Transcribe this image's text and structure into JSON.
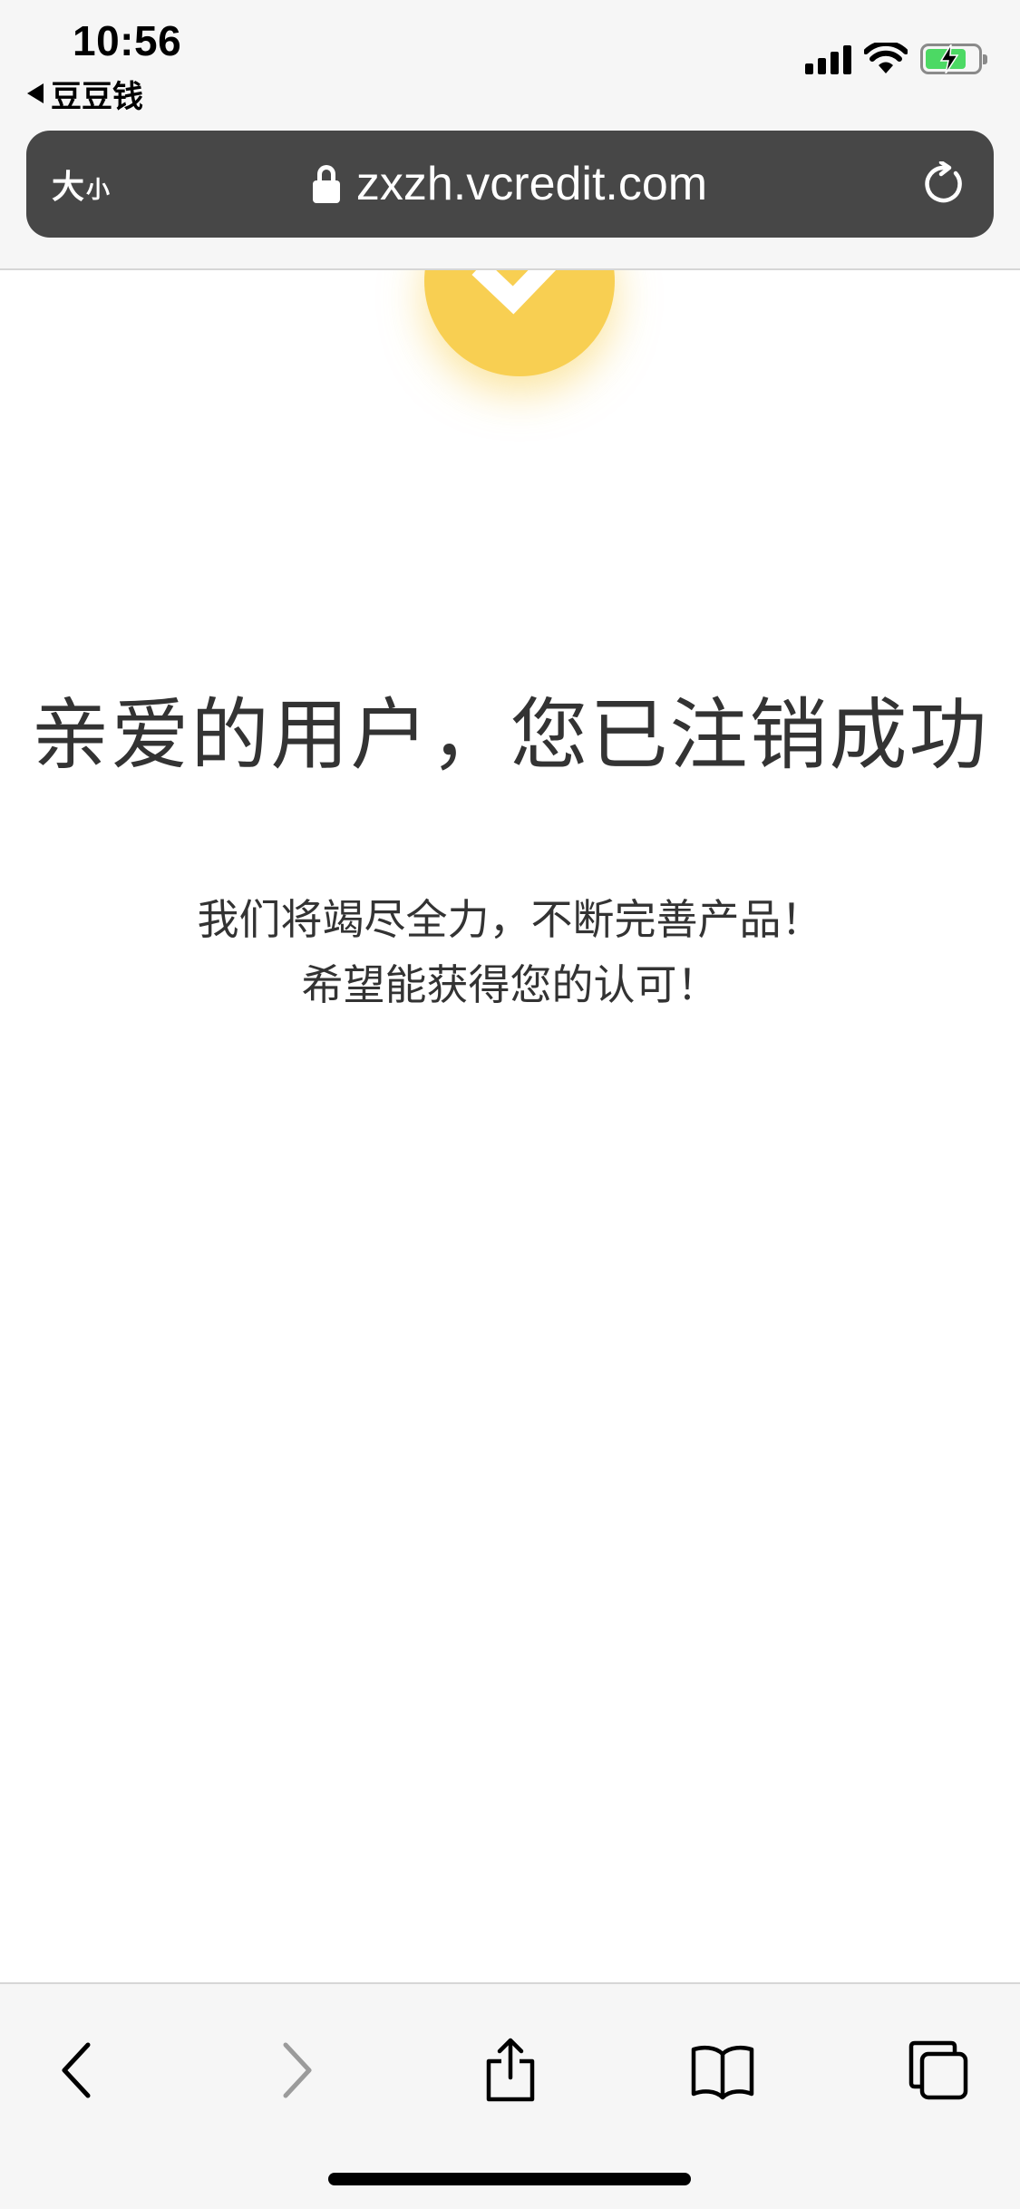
{
  "status_bar": {
    "time": "10:56",
    "back_app": "豆豆钱"
  },
  "browser": {
    "text_size_large": "大",
    "text_size_small": "小",
    "url": "zxzh.vcredit.com"
  },
  "content": {
    "title": "亲爱的用户，您已注销成功",
    "message_lines": [
      "我们将竭尽全力，不断完善产品！",
      "希望能获得您的认可！"
    ]
  },
  "colors": {
    "accent": "#f8cf52",
    "battery": "#4cd964",
    "url_bar": "#474747"
  },
  "icons": {
    "status": [
      "signal-icon",
      "wifi-icon",
      "battery-charging-icon"
    ],
    "toolbar": [
      "back-arrow-icon",
      "forward-arrow-icon",
      "share-icon",
      "bookmarks-icon",
      "tabs-icon"
    ]
  }
}
